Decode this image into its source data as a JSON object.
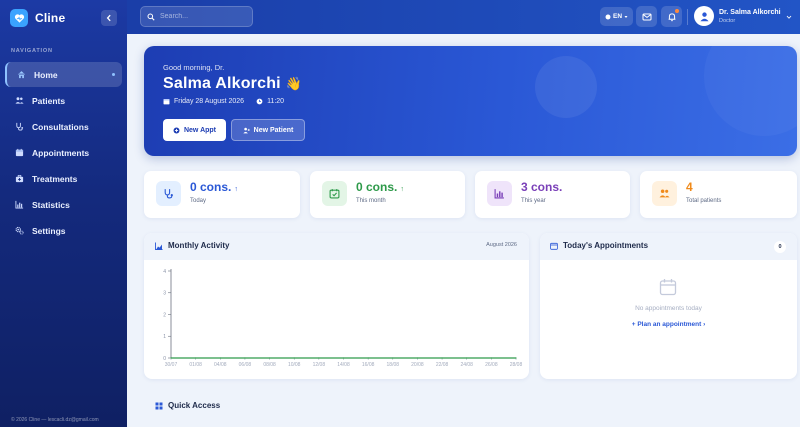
{
  "app": {
    "name": "Cline",
    "footer": "© 2026 Cline — lescacli.dz@gmail.com"
  },
  "sidebar": {
    "section_label": "NAVIGATION",
    "items": [
      {
        "label": "Home",
        "icon": "home-icon",
        "active": true
      },
      {
        "label": "Patients",
        "icon": "users-icon"
      },
      {
        "label": "Consultations",
        "icon": "stethoscope-icon"
      },
      {
        "label": "Appointments",
        "icon": "calendar-icon"
      },
      {
        "label": "Treatments",
        "icon": "medkit-icon"
      },
      {
        "label": "Statistics",
        "icon": "bar-chart-icon"
      },
      {
        "label": "Settings",
        "icon": "gears-icon"
      }
    ]
  },
  "topbar": {
    "search_placeholder": "Search...",
    "language": "EN",
    "user": {
      "name": "Dr. Salma Alkorchi",
      "role": "Doctor"
    }
  },
  "hero": {
    "greeting": "Good morning, Dr.",
    "name": "Salma Alkorchi",
    "emoji": "👋",
    "date": "Friday 28 August 2026",
    "time": "11:20",
    "new_appt_label": "New Appt",
    "new_patient_label": "New Patient"
  },
  "stats": [
    {
      "value": "0 cons.",
      "arrow": "↑",
      "label": "Today",
      "color": "#2a58d6",
      "bg": "#e3efff"
    },
    {
      "value": "0 cons.",
      "arrow": "↑",
      "label": "This month",
      "color": "#2e9a4a",
      "bg": "#e3f5e6"
    },
    {
      "value": "3 cons.",
      "arrow": "",
      "label": "This year",
      "color": "#7a3fb8",
      "bg": "#efe4fa"
    },
    {
      "value": "4",
      "arrow": "",
      "label": "Total patients",
      "color": "#f08a1a",
      "bg": "#fff1de"
    }
  ],
  "activity": {
    "title": "Monthly Activity",
    "month": "August 2026"
  },
  "today": {
    "title": "Today's Appointments",
    "count": "0",
    "empty_text": "No appointments today",
    "plan_link": "+ Plan an appointment ›"
  },
  "quick_access": {
    "title": "Quick Access"
  },
  "chart_data": {
    "type": "line",
    "title": "",
    "xlabel": "",
    "ylabel": "",
    "x": [
      "30/07",
      "01/08",
      "04/08",
      "06/08",
      "08/08",
      "10/08",
      "12/08",
      "14/08",
      "16/08",
      "18/08",
      "20/08",
      "22/08",
      "24/08",
      "26/08",
      "28/08"
    ],
    "yticks": [
      0,
      1,
      2,
      3,
      4
    ],
    "ylim": [
      0,
      4
    ],
    "series": [
      {
        "values": [
          0,
          0,
          0,
          0,
          0,
          0,
          0,
          0,
          0,
          0,
          0,
          0,
          0,
          0,
          0
        ],
        "color": "#2e9a4a"
      }
    ],
    "grid": false
  }
}
